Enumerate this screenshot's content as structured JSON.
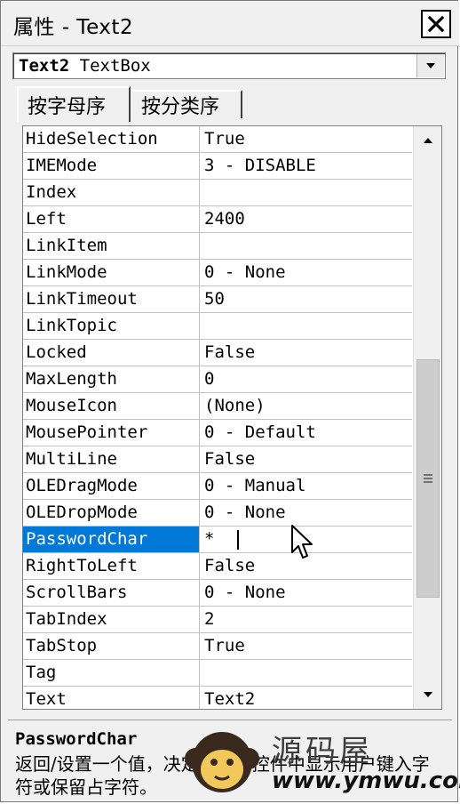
{
  "window": {
    "title": "属性 - Text2"
  },
  "object_selector": {
    "name": "Text2",
    "type": "TextBox"
  },
  "tabs": [
    {
      "label": "按字母序",
      "active": true
    },
    {
      "label": "按分类序",
      "active": false
    }
  ],
  "properties": [
    {
      "name": "HideSelection",
      "value": "True"
    },
    {
      "name": "IMEMode",
      "value": "3 - DISABLE"
    },
    {
      "name": "Index",
      "value": ""
    },
    {
      "name": "Left",
      "value": "2400"
    },
    {
      "name": "LinkItem",
      "value": ""
    },
    {
      "name": "LinkMode",
      "value": "0 - None"
    },
    {
      "name": "LinkTimeout",
      "value": "50"
    },
    {
      "name": "LinkTopic",
      "value": ""
    },
    {
      "name": "Locked",
      "value": "False"
    },
    {
      "name": "MaxLength",
      "value": "0"
    },
    {
      "name": "MouseIcon",
      "value": "(None)"
    },
    {
      "name": "MousePointer",
      "value": "0 - Default"
    },
    {
      "name": "MultiLine",
      "value": "False"
    },
    {
      "name": "OLEDragMode",
      "value": "0 - Manual"
    },
    {
      "name": "OLEDropMode",
      "value": "0 - None"
    },
    {
      "name": "PasswordChar",
      "value": "*",
      "selected": true
    },
    {
      "name": "RightToLeft",
      "value": "False"
    },
    {
      "name": "ScrollBars",
      "value": "0 - None"
    },
    {
      "name": "TabIndex",
      "value": "2"
    },
    {
      "name": "TabStop",
      "value": "True"
    },
    {
      "name": "Tag",
      "value": ""
    },
    {
      "name": "Text",
      "value": "Text2"
    }
  ],
  "description": {
    "title": "PasswordChar",
    "text": "返回/设置一个值，决定是否在控件中显示用户键入字符或保留占字符。"
  },
  "watermark": {
    "cn": "源码屋",
    "url": "www.ymwu.com"
  },
  "colors": {
    "selection": "#0078d7",
    "window_bg": "#f0f0f0"
  },
  "icons": [
    "close-icon",
    "dropdown-arrow-icon",
    "scroll-up-icon",
    "scroll-down-icon",
    "scroll-grip-icon",
    "mouse-pointer-icon"
  ]
}
